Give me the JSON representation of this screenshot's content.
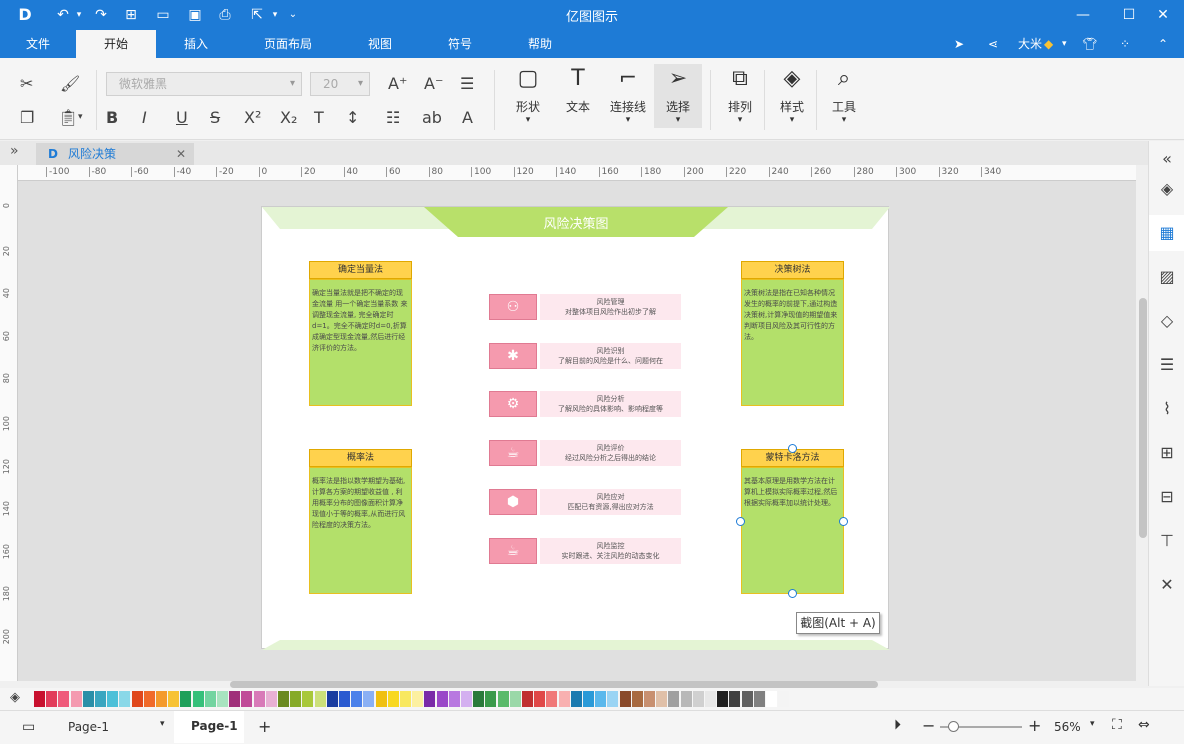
{
  "app": {
    "title": "亿图图示"
  },
  "menu": {
    "file": "文件",
    "tabs": [
      "开始",
      "插入",
      "页面布局",
      "视图",
      "符号",
      "帮助"
    ],
    "user": "大米"
  },
  "ribbon": {
    "font_family": "微软雅黑",
    "font_size": "20",
    "buttons": {
      "shape": "形状",
      "text": "文本",
      "connector": "连接线",
      "select": "选择",
      "arrange": "排列",
      "style": "样式",
      "tools": "工具"
    }
  },
  "document": {
    "tab_name": "风险决策"
  },
  "rulers": {
    "h_labels": [
      "-100",
      "-80",
      "-60",
      "-40",
      "-20",
      "0",
      "20",
      "40",
      "60",
      "80",
      "100",
      "120",
      "140",
      "160",
      "180",
      "200",
      "220",
      "240",
      "260",
      "280",
      "300",
      "320",
      "340"
    ],
    "v_labels": [
      "0",
      "20",
      "40",
      "60",
      "80",
      "100",
      "120",
      "140",
      "160",
      "180",
      "200"
    ]
  },
  "diagram": {
    "title": "风险决策图",
    "cards": [
      {
        "title": "确定当量法",
        "body": "确定当量法就是把不确定的现金流量 用一个确定当量系数 来调整现金流量, 完全确定时d=1。完全不确定时d=0,折算成确定型现金流量,然后进行经济评价的方法。"
      },
      {
        "title": "概率法",
        "body": "概率法是指以数学期望为基础, 计算各方案的期望收益值 , 利用概率分布的图像面积计算净现值小于等的概率,从而进行风险程度的决策方法。"
      },
      {
        "title": "决策树法",
        "body": "决策树法是指在已知各种情况发生的概率的前提下,通过构造决策树,计算净现值的期望值来判断项目风险及其可行性的方法。"
      },
      {
        "title": "蒙特卡洛方法",
        "body": "其基本原理是用数学方法在计算机上模拟实际概率过程,然后根据实际概率加以统计处理。"
      }
    ],
    "steps": [
      {
        "name": "风险管理",
        "desc": "对整体项目风险作出初步了解",
        "icon": "person-icon"
      },
      {
        "name": "风险识别",
        "desc": "了解目前的风险是什么、问题何在",
        "icon": "bug-icon"
      },
      {
        "name": "风险分析",
        "desc": "了解风险的具体影响、影响程度等",
        "icon": "gears-icon"
      },
      {
        "name": "风险评价",
        "desc": "经过风险分析之后得出的结论",
        "icon": "cup-icon"
      },
      {
        "name": "风险应对",
        "desc": "匹配已有资源,得出应对方法",
        "icon": "cube-icon"
      },
      {
        "name": "风险监控",
        "desc": "实时跟进、关注风险的动态变化",
        "icon": "cup-icon"
      }
    ]
  },
  "tooltip": "截图(Alt + A)",
  "status": {
    "page_select": "Page-1",
    "page_tab": "Page-1",
    "zoom": "56%"
  },
  "palette": [
    "#c8102e",
    "#e23b5a",
    "#ef5a7a",
    "#f49ab0",
    "#2a8fa8",
    "#3aa6c0",
    "#4cc0d8",
    "#8ad8e8",
    "#e0481c",
    "#f06a2a",
    "#f49a2c",
    "#f7c234",
    "#1ea05a",
    "#35c07a",
    "#72d4a0",
    "#a8e4c0",
    "#a0307a",
    "#c04a98",
    "#d87ab8",
    "#e8b0d4",
    "#6a8a20",
    "#86aa28",
    "#a8c83a",
    "#cce07a",
    "#1a3ca0",
    "#2a5ad0",
    "#4a80ea",
    "#8ab0f4",
    "#f0c010",
    "#f8d820",
    "#f8e860",
    "#fcf0a0",
    "#7a2aa8",
    "#9a48c8",
    "#b878e0",
    "#d4b0f0",
    "#2a7a3a",
    "#3a9a4a",
    "#5aba6a",
    "#9ad8a8",
    "#c03030",
    "#e04848",
    "#f07878",
    "#f8b0b0",
    "#1a7ab0",
    "#2a9ad8",
    "#5ab8ec",
    "#9ad4f4",
    "#8a4a2a",
    "#a86a40",
    "#c89070",
    "#e0c0a8",
    "#a0a0a0",
    "#b8b8b8",
    "#d0d0d0",
    "#e8e8e8",
    "#202020",
    "#404040",
    "#606060",
    "#808080",
    "#ffffff",
    "#f4f4f4"
  ]
}
